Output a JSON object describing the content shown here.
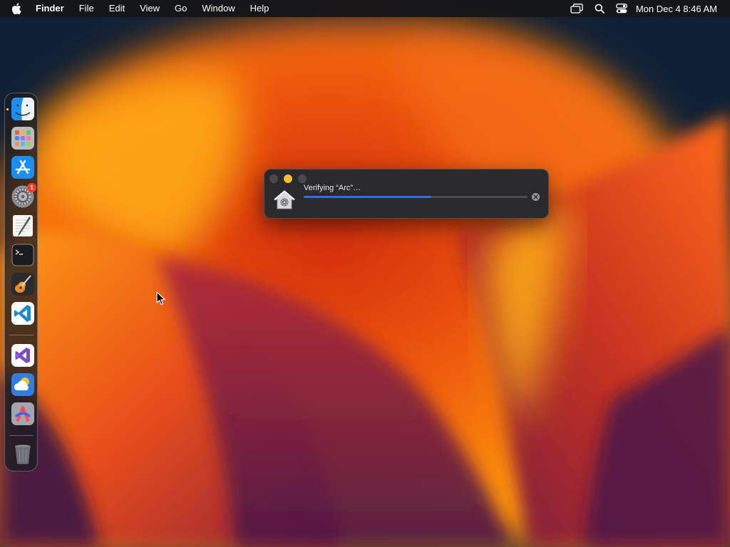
{
  "menubar": {
    "apple_icon": "apple-logo-icon",
    "items": [
      "Finder",
      "File",
      "Edit",
      "View",
      "Go",
      "Window",
      "Help"
    ],
    "status_icons": [
      "screen-mirroring-icon",
      "spotlight-search-icon",
      "control-center-icon"
    ],
    "clock": "Mon Dec 4  8:46 AM"
  },
  "dock": {
    "items": [
      {
        "name": "Finder",
        "icon": "finder-icon",
        "running": true
      },
      {
        "name": "Launchpad",
        "icon": "launchpad-icon"
      },
      {
        "name": "App Store",
        "icon": "app-store-icon"
      },
      {
        "name": "System Settings",
        "icon": "system-settings-icon",
        "badge": "1"
      },
      {
        "name": "TextEdit",
        "icon": "textedit-icon"
      },
      {
        "name": "Terminal",
        "icon": "terminal-icon"
      },
      {
        "name": "GarageBand",
        "icon": "garageband-icon"
      },
      {
        "name": "Visual Studio Code",
        "icon": "vscode-icon"
      },
      {
        "name": "Visual Studio",
        "icon": "visual-studio-icon"
      },
      {
        "name": "Weather",
        "icon": "weather-icon"
      },
      {
        "name": "Arc",
        "icon": "arc-icon"
      },
      {
        "name": "Trash",
        "icon": "trash-icon"
      }
    ]
  },
  "verify_window": {
    "label": "Verifying “Arc”…",
    "progress": 0.57,
    "icon": "installer-house-icon",
    "cancel_icon": "cancel-x-icon"
  },
  "colors": {
    "accent": "#2f6fe4",
    "minimize": "#febc2e",
    "badge": "#ff3b30"
  }
}
